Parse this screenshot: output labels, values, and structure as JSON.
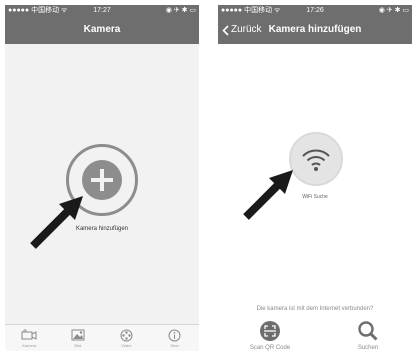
{
  "left": {
    "statusbar": {
      "carrier": "●●●●● 中国移动 ᯤ",
      "time": "17:27",
      "right": "◉ ✈ ✱ ▭"
    },
    "nav": {
      "title": "Kamera"
    },
    "add": {
      "label": "Kamera hinzufügen"
    },
    "tabs": [
      {
        "label": "Kamera",
        "icon": "camera-icon"
      },
      {
        "label": "Bild",
        "icon": "image-icon"
      },
      {
        "label": "Video",
        "icon": "film-reel-icon"
      },
      {
        "label": "Über",
        "icon": "info-icon"
      }
    ]
  },
  "right": {
    "statusbar": {
      "carrier": "●●●●● 中国移动 ᯤ",
      "time": "17:26",
      "right": "◉ ✈ ✱ ▭"
    },
    "nav": {
      "back": "Zurück",
      "title": "Kamera hinzufügen"
    },
    "wifi": {
      "label": "WiFi Suche"
    },
    "question": "Die kamera ist mit dem Internet verbunden?",
    "scan": {
      "label": "Scan QR Code"
    },
    "search": {
      "label": "Suchen"
    }
  }
}
